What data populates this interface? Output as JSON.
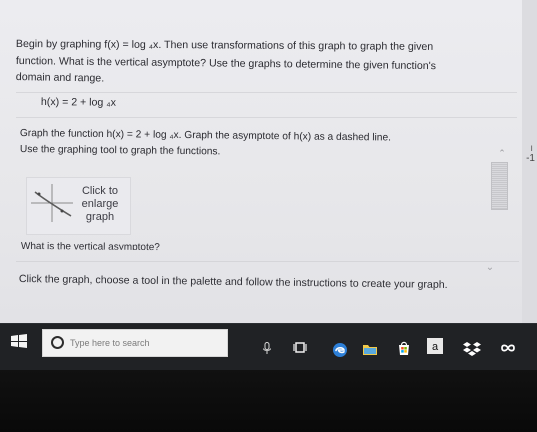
{
  "question": {
    "line1": "Begin by graphing f(x) = log ₄x. Then use transformations of this graph to graph the given",
    "line2": "function. What is the vertical asymptote? Use the graphs to determine the given function's",
    "line3": "domain and range."
  },
  "function_display": {
    "text": "h(x) = 2 + log ₄x"
  },
  "graph_instructions": {
    "line1": "Graph the function h(x) = 2 + log ₄x. Graph  the asymptote of h(x) as a dashed line.",
    "line2": "Use the graphing tool to graph the functions."
  },
  "thumbnail": {
    "label_line1": "Click to",
    "label_line2": "enlarge",
    "label_line3": "graph"
  },
  "asymptote_question": {
    "text": "What is the vertical asymptote?"
  },
  "instruction_bar": {
    "text": "Click the graph, choose a tool in the palette and follow the instructions to create your graph."
  },
  "right_gutter": {
    "char1": "ı",
    "char2": "-1"
  },
  "taskbar": {
    "search_placeholder": "Type here to search",
    "amazon_label": "a"
  },
  "icons": {
    "start": "windows-start-icon",
    "search": "search-icon",
    "mic": "microphone-icon",
    "taskview": "task-view-icon",
    "edge": "edge-browser-icon",
    "folder": "file-explorer-icon",
    "store": "store-icon",
    "amazon": "amazon-icon",
    "dropbox": "dropbox-icon",
    "infinity": "infinity-icon"
  },
  "colors": {
    "page_bg": "#e9e9ec",
    "text": "#2b2b31",
    "taskbar_bg": "#202225",
    "edge_blue": "#2d7fd7",
    "folder_yellow": "#f0c94a",
    "store_green": "#39b54a",
    "amazon_gray": "#e5e5e5",
    "dropbox_white": "#ffffff"
  }
}
